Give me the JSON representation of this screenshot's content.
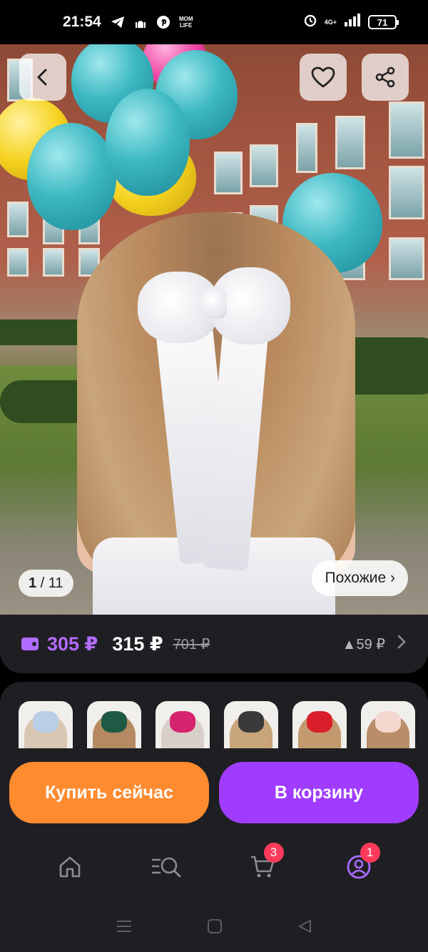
{
  "status_bar": {
    "time": "21:54",
    "left_icons": [
      "telegram-icon",
      "mosque-icon",
      "pinterest-icon",
      "momlife-icon"
    ],
    "momlife_text": "MOM LIFE",
    "network": "4G+",
    "battery": "71"
  },
  "gallery": {
    "current": "1",
    "total": "11",
    "similar_label": "Похожие ›"
  },
  "price": {
    "wallet_price": "305 ₽",
    "price": "315 ₽",
    "old_price": "701 ₽",
    "price_change": "▲59 ₽"
  },
  "thumbnails": [
    {
      "bow_color": "#b9cfe6",
      "hair": "#d9c7b3"
    },
    {
      "bow_color": "#1e5a44",
      "hair": "#b58a62"
    },
    {
      "bow_color": "#d6246f",
      "hair": "#d8d0c8"
    },
    {
      "bow_color": "#3a3a3a",
      "hair": "#c8a47b"
    },
    {
      "bow_color": "#d81f2a",
      "hair": "#c39a6d"
    },
    {
      "bow_color": "#f3d7cf",
      "hair": "#b88d67"
    }
  ],
  "actions": {
    "buy_now": "Купить сейчас",
    "add_to_cart": "В корзину"
  },
  "bottom_nav": {
    "items": [
      "home-icon",
      "catalog-search-icon",
      "cart-icon",
      "profile-icon"
    ],
    "cart_badge": "3",
    "profile_badge": "1",
    "active": "profile",
    "active_color": "#a86cff"
  },
  "colors": {
    "buy": "#ff8b30",
    "cart": "#a03cff",
    "wallet_price": "#b36bff"
  }
}
